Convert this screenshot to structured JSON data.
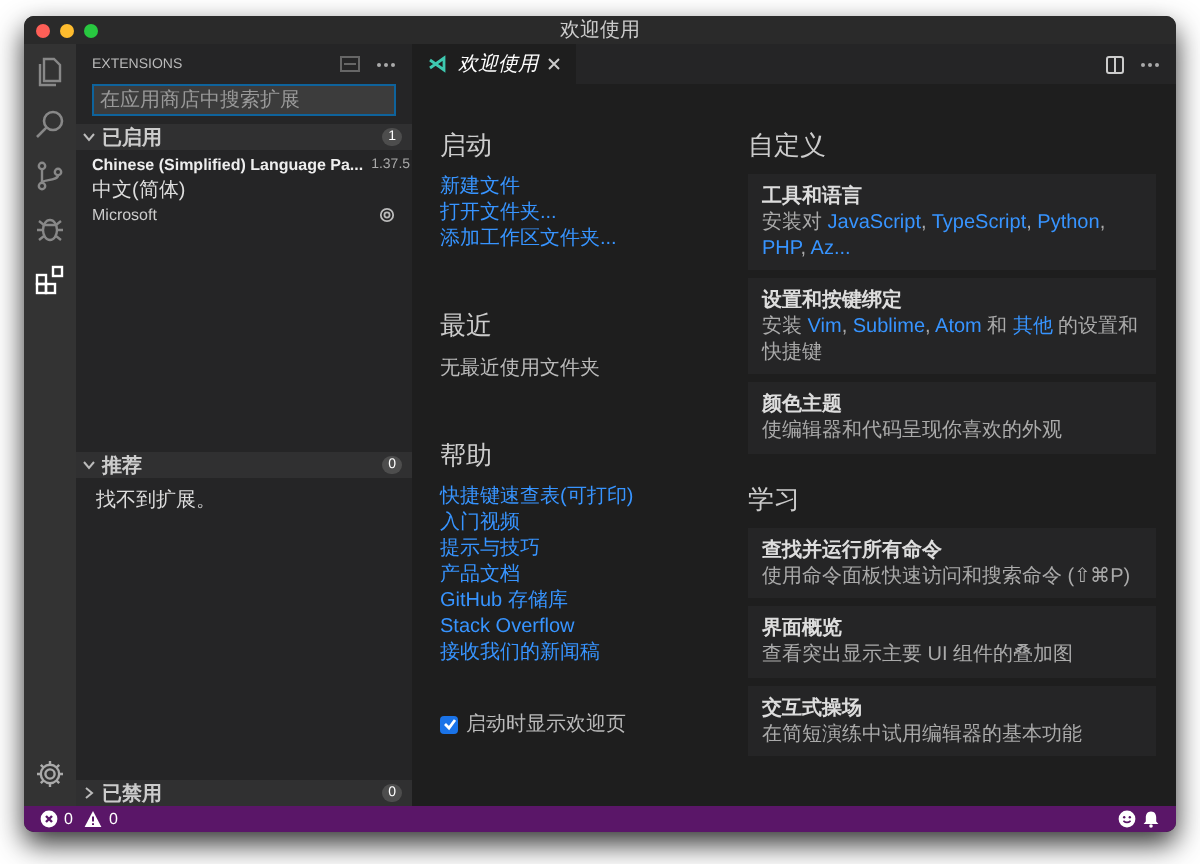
{
  "window": {
    "title": "欢迎使用"
  },
  "activity_bar": {
    "items": [
      {
        "kind": "files",
        "selected": false
      },
      {
        "kind": "search",
        "selected": false
      },
      {
        "kind": "source-control",
        "selected": false
      },
      {
        "kind": "debug",
        "selected": false
      },
      {
        "kind": "extensions",
        "selected": true
      }
    ]
  },
  "sidebar": {
    "title": "EXTENSIONS",
    "search": {
      "placeholder": "在应用商店中搜索扩展"
    },
    "sections": [
      {
        "label": "已启用",
        "count": "1",
        "expanded": true,
        "extensions": [
          {
            "name": "Chinese (Simplified) Language Pa...",
            "version": "1.37.5",
            "description": "中文(简体)",
            "publisher": "Microsoft"
          }
        ]
      },
      {
        "label": "推荐",
        "count": "0",
        "expanded": true,
        "message": "找不到扩展。"
      },
      {
        "label": "已禁用",
        "count": "0",
        "expanded": false
      }
    ]
  },
  "editor": {
    "tabs": [
      {
        "label": "欢迎使用",
        "selected": true
      }
    ],
    "start": {
      "title": "启动",
      "links": [
        "新建文件",
        "打开文件夹...",
        "添加工作区文件夹..."
      ]
    },
    "recent": {
      "title": "最近",
      "message": "无最近使用文件夹"
    },
    "help": {
      "title": "帮助",
      "links": [
        "快捷键速查表(可打印)",
        "入门视频",
        "提示与技巧",
        "产品文档",
        "GitHub 存储库",
        "Stack Overflow",
        "接收我们的新闻稿"
      ]
    },
    "show_on_startup": {
      "label": "启动时显示欢迎页",
      "checked": true
    },
    "customize": {
      "title": "自定义",
      "cards": [
        {
          "title": "工具和语言",
          "description": [
            {
              "kind": "text",
              "text": "安装对 "
            },
            {
              "kind": "link",
              "text": "JavaScript"
            },
            {
              "kind": "text",
              "text": ", "
            },
            {
              "kind": "link",
              "text": "TypeScript"
            },
            {
              "kind": "text",
              "text": ", "
            },
            {
              "kind": "link",
              "text": "Python"
            },
            {
              "kind": "text",
              "text": ", "
            },
            {
              "kind": "link",
              "text": "PHP"
            },
            {
              "kind": "text",
              "text": ", "
            },
            {
              "kind": "link",
              "text": "Az..."
            }
          ]
        },
        {
          "title": "设置和按键绑定",
          "description": [
            {
              "kind": "text",
              "text": "安装 "
            },
            {
              "kind": "link",
              "text": "Vim"
            },
            {
              "kind": "text",
              "text": ", "
            },
            {
              "kind": "link",
              "text": "Sublime"
            },
            {
              "kind": "text",
              "text": ", "
            },
            {
              "kind": "link",
              "text": "Atom"
            },
            {
              "kind": "text",
              "text": " 和 "
            },
            {
              "kind": "link",
              "text": "其他"
            },
            {
              "kind": "text",
              "text": " 的设置和快捷键"
            }
          ]
        },
        {
          "title": "颜色主题",
          "description": [
            {
              "kind": "text",
              "text": "使编辑器和代码呈现你喜欢的外观"
            }
          ]
        }
      ]
    },
    "learn": {
      "title": "学习",
      "cards": [
        {
          "title": "查找并运行所有命令",
          "description": [
            {
              "kind": "text",
              "text": "使用命令面板快速访问和搜索命令 (⇧⌘P)"
            }
          ]
        },
        {
          "title": "界面概览",
          "description": [
            {
              "kind": "text",
              "text": "查看突出显示主要 UI 组件的叠加图"
            }
          ]
        },
        {
          "title": "交互式操场",
          "description": [
            {
              "kind": "text",
              "text": "在简短演练中试用编辑器的基本功能"
            }
          ]
        }
      ]
    }
  },
  "status_bar": {
    "errors": "0",
    "warnings": "0"
  }
}
